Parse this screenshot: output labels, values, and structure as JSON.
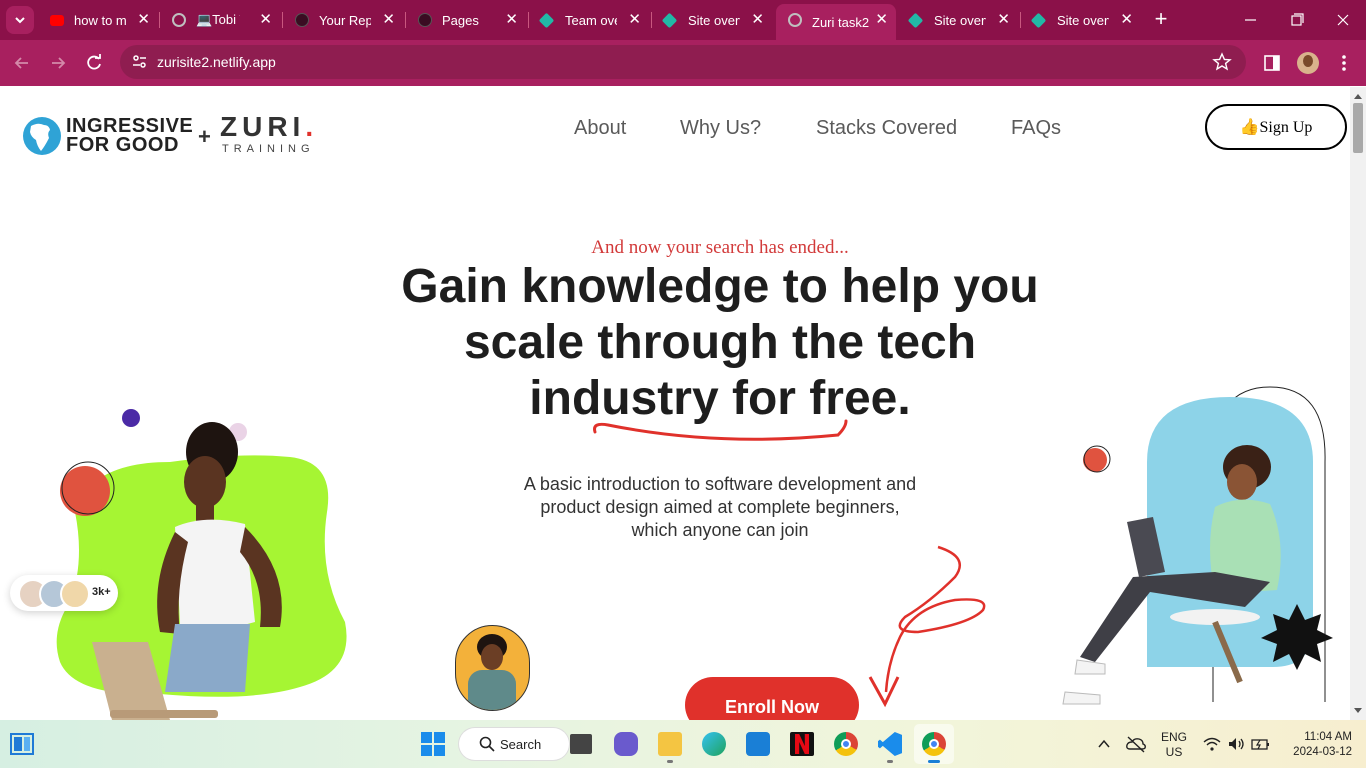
{
  "browser": {
    "tabs": [
      {
        "label": "how to m",
        "favicon_color": "#ff0000"
      },
      {
        "label": "💻Tobi W",
        "favicon_color": "#bfbfbf"
      },
      {
        "label": "Your Repo",
        "favicon_color": "#222222"
      },
      {
        "label": "Pages",
        "favicon_color": "#222222"
      },
      {
        "label": "Team over",
        "favicon_color": "#22b8a6"
      },
      {
        "label": "Site overv",
        "favicon_color": "#22b8a6"
      },
      {
        "label": "Zuri task2",
        "favicon_color": "#bfbfbf",
        "active": true
      },
      {
        "label": "Site overv",
        "favicon_color": "#22b8a6"
      },
      {
        "label": "Site overv",
        "favicon_color": "#22b8a6"
      }
    ],
    "url": "zurisite2.netlify.app"
  },
  "site": {
    "logo_left": [
      "INGRESSIVE",
      "FOR GOOD"
    ],
    "logo_plus": "+",
    "logo_right": "ZURI",
    "logo_dot": ".",
    "logo_right_sub": "TRAINING",
    "nav": [
      "About",
      "Why Us?",
      "Stacks Covered",
      "FAQs"
    ],
    "signup_label": "👍Sign Up",
    "tagline": "And now your search has ended...",
    "headline": "Gain knowledge to help you scale through the tech industry for free.",
    "subtext": "A basic introduction to software development and product design aimed at complete beginners, which anyone can join",
    "users_count": "3k+",
    "enroll_label": "Enroll Now"
  },
  "colors": {
    "browser_frame": "#8b1149",
    "accent_red": "#e0312b",
    "lime": "#a6f533",
    "sky_blue": "#8dd3e8",
    "purple": "#4b2aa6"
  },
  "taskbar": {
    "search_label": "Search",
    "lang_top": "ENG",
    "lang_bottom": "US",
    "time": "11:04 AM",
    "date": "2024-03-12"
  }
}
